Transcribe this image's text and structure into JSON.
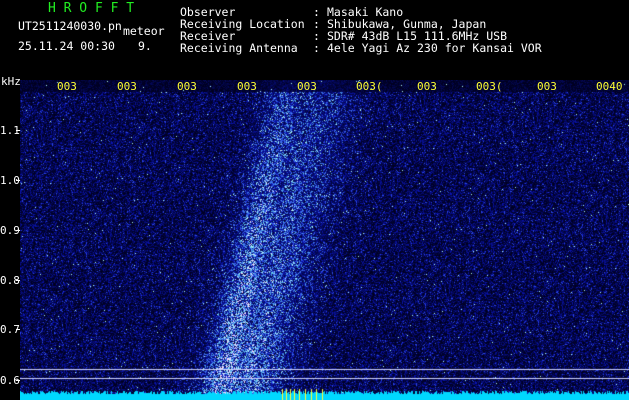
{
  "header": {
    "app_name": "H R O F F T",
    "file_name": "UT2511240030.pn",
    "category": "meteor",
    "timestamp": "25.11.24 00:30",
    "count": "9.",
    "info": [
      {
        "label": "Observer",
        "value": "Masaki Kano"
      },
      {
        "label": "Receiving Location",
        "value": "Shibukawa, Gunma, Japan"
      },
      {
        "label": "Receiver",
        "value": "SDR# 43dB L15 111.6MHz USB"
      },
      {
        "label": "Receiving Antenna",
        "value": "4ele Yagi Az 230 for Kansai VOR"
      }
    ]
  },
  "axis": {
    "unit": "kHz",
    "y_ticks": [
      "1.1",
      "1.0",
      "0.9",
      "0.8",
      "0.7",
      "0.6"
    ],
    "x_labels": [
      "003",
      "003",
      "003",
      "003",
      "003",
      "003(",
      "003",
      "003(",
      "003",
      "0040"
    ]
  },
  "colors": {
    "background": "#000000",
    "noise": "#0a12a0",
    "signal": "#3a7dff",
    "baseline": "#00d8ff",
    "label_yellow": "#ffff33",
    "title_green": "#22ee22"
  }
}
